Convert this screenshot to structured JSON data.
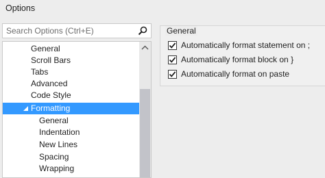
{
  "window": {
    "title": "Options"
  },
  "search": {
    "placeholder": "Search Options (Ctrl+E)"
  },
  "tree": {
    "items": [
      {
        "label": "General"
      },
      {
        "label": "Scroll Bars"
      },
      {
        "label": "Tabs"
      },
      {
        "label": "Advanced"
      },
      {
        "label": "Code Style"
      },
      {
        "label": "Formatting",
        "expanded": true,
        "selected": true
      },
      {
        "label": "General"
      },
      {
        "label": "Indentation"
      },
      {
        "label": "New Lines"
      },
      {
        "label": "Spacing"
      },
      {
        "label": "Wrapping"
      }
    ]
  },
  "formatting": {
    "group_title": "General",
    "options": [
      {
        "label": "Automatically format statement on ;",
        "checked": true
      },
      {
        "label": "Automatically format block on }",
        "checked": true
      },
      {
        "label": "Automatically format on paste",
        "checked": true
      }
    ]
  },
  "icons": {
    "search": "search-icon",
    "expanded": "expanded-triangle-icon",
    "scroll_up": "scroll-up-arrow-icon",
    "check": "checkmark-icon"
  },
  "colors": {
    "selection": "#3399ff",
    "background": "#ededed",
    "scroll_thumb": "#c2c3c9"
  }
}
